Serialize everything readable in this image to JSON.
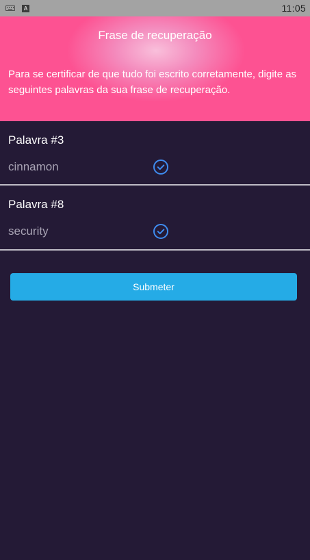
{
  "status_bar": {
    "time": "11:05",
    "icons": [
      "keyboard-icon",
      "a-badge-icon"
    ]
  },
  "header": {
    "title": "Frase de recuperação",
    "description": "Para se certificar de que tudo foi escrito corretamente, digite as seguintes palavras da sua frase de recuperação."
  },
  "words": [
    {
      "label": "Palavra #3",
      "value": "cinnamon",
      "status_icon": "check-circle-icon"
    },
    {
      "label": "Palavra #8",
      "value": "security",
      "status_icon": "check-circle-icon"
    }
  ],
  "submit_label": "Submeter",
  "colors": {
    "header_pink": "#fd5292",
    "background": "#241a36",
    "button_blue": "#25abe6",
    "check_blue": "#3f8cf0"
  }
}
